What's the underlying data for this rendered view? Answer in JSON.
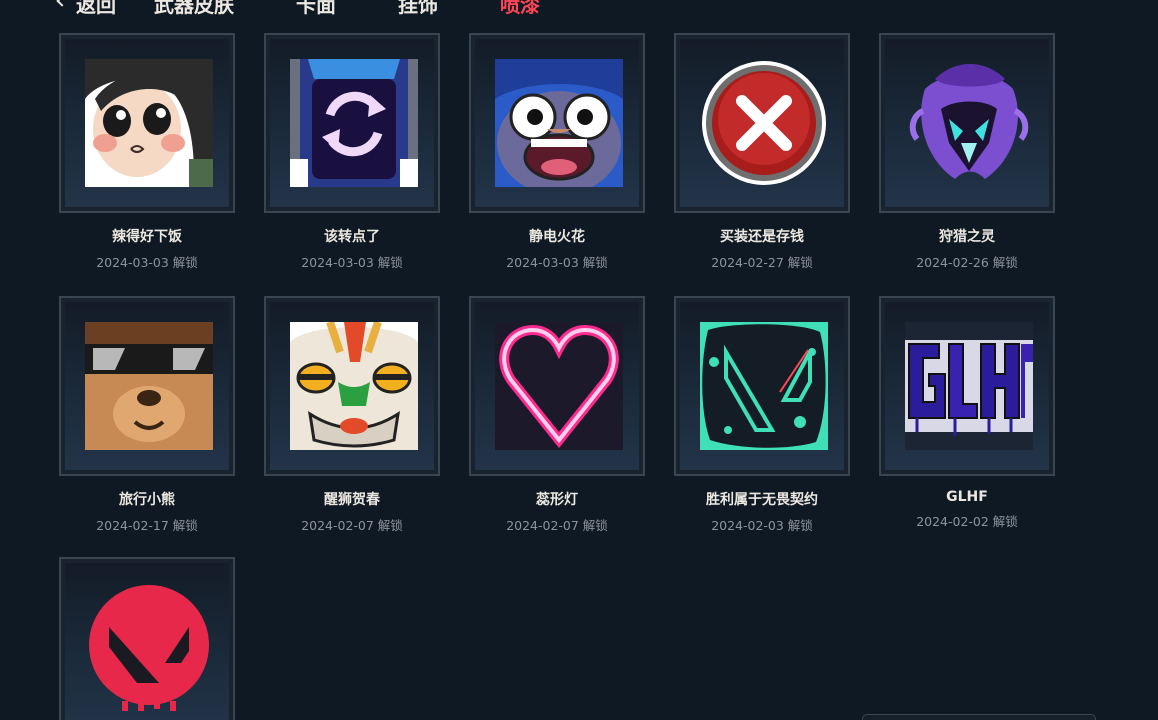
{
  "nav": {
    "back_label": "返回",
    "tabs": [
      {
        "label": "武器皮肤",
        "active": false
      },
      {
        "label": "卡面",
        "active": false
      },
      {
        "label": "挂饰",
        "active": false
      },
      {
        "label": "喷漆",
        "active": true
      }
    ],
    "accent_color": "#ff4655"
  },
  "sprays": [
    {
      "name": "辣得好下饭",
      "date": "2024-03-03 解锁",
      "icon": "spicy-girl-icon"
    },
    {
      "name": "该转点了",
      "date": "2024-03-03 解锁",
      "icon": "rotate-icon"
    },
    {
      "name": "静电火花",
      "date": "2024-03-03 解锁",
      "icon": "shocked-face-icon"
    },
    {
      "name": "买装还是存钱",
      "date": "2024-02-27 解锁",
      "icon": "red-x-icon"
    },
    {
      "name": "狩猎之灵",
      "date": "2024-02-26 解锁",
      "icon": "hunter-spirit-icon"
    },
    {
      "name": "旅行小熊",
      "date": "2024-02-17 解锁",
      "icon": "bear-sunglasses-icon"
    },
    {
      "name": "醒狮贺春",
      "date": "2024-02-07 解锁",
      "icon": "lion-dance-icon"
    },
    {
      "name": "蕊形灯",
      "date": "2024-02-07 解锁",
      "icon": "neon-heart-icon"
    },
    {
      "name": "胜利属于无畏契约",
      "date": "2024-02-03 解锁",
      "icon": "valorant-splatter-icon"
    },
    {
      "name": "GLHF",
      "date": "2024-02-02 解锁",
      "icon": "glhf-graffiti-icon"
    },
    {
      "name": "",
      "date": "",
      "icon": "valorant-logo-icon"
    }
  ]
}
